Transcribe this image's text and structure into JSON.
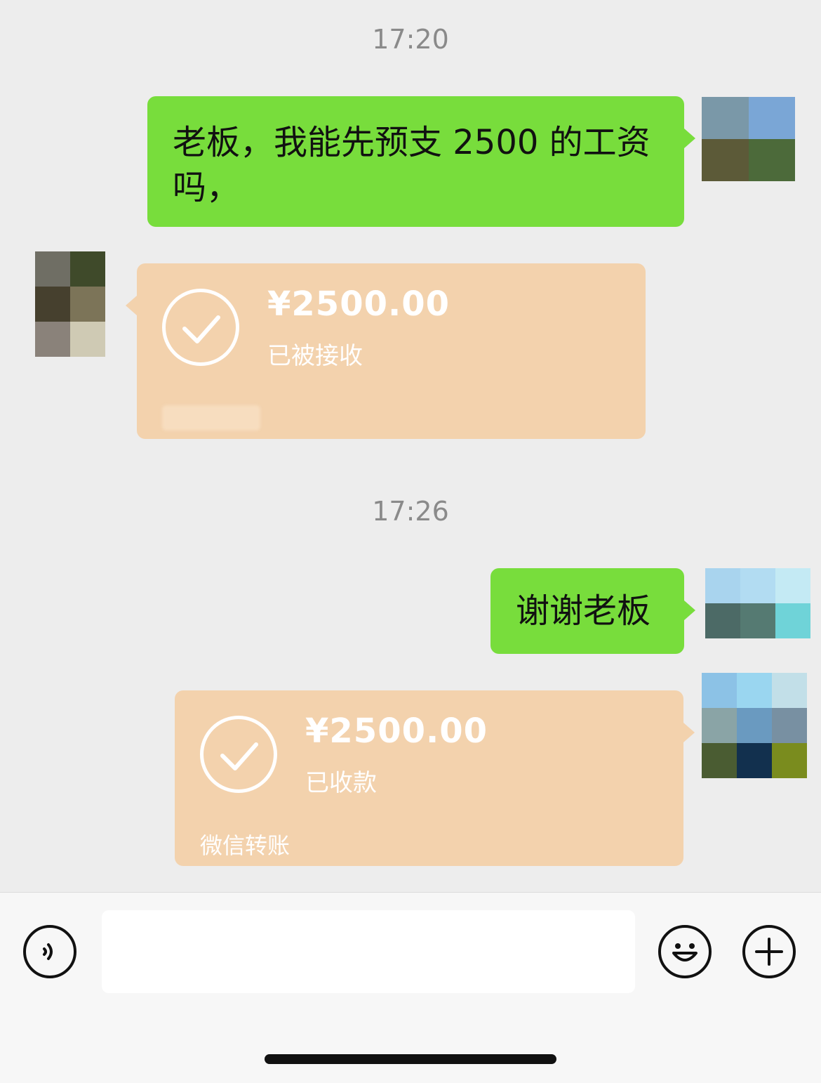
{
  "conversation": {
    "timestamp_1": "17:20",
    "message_1": "老板，我能先预支 2500 的工资吗，",
    "transfer_1": {
      "amount": "¥2500.00",
      "status": "已被接收",
      "footer": ""
    },
    "timestamp_2": "17:26",
    "message_2": "谢谢老板",
    "transfer_2": {
      "amount": "¥2500.00",
      "status": "已收款",
      "footer": "微信转账"
    }
  },
  "input_bar": {
    "text_value": "",
    "voice_icon": "voice-icon",
    "emoji_icon": "emoji-icon",
    "plus_icon": "plus-icon"
  },
  "colors": {
    "background": "#ededed",
    "sent_bubble": "#78dd3c",
    "transfer_card": "#f3d2ad"
  }
}
